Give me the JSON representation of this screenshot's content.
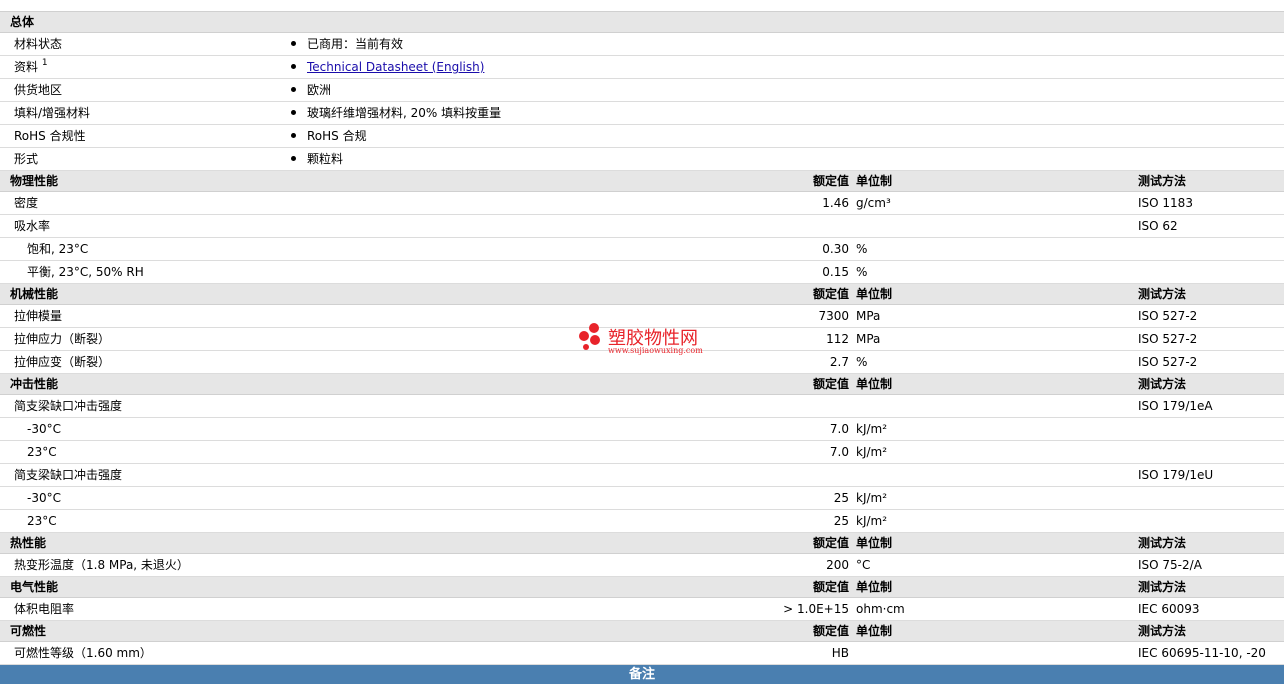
{
  "sections": {
    "general": {
      "title": "总体",
      "rows": [
        {
          "label": "材料状态",
          "value": "已商用：当前有效"
        },
        {
          "label": "资料",
          "sup": "1",
          "value": "Technical Datasheet (English)",
          "link": true
        },
        {
          "label": "供货地区",
          "value": "欧洲"
        },
        {
          "label": "填料/增强材料",
          "value": "玻璃纤维增强材料, 20% 填料按重量"
        },
        {
          "label": "RoHS 合规性",
          "value": "RoHS 合规"
        },
        {
          "label": "形式",
          "value": "颗粒料"
        }
      ]
    },
    "physical": {
      "title": "物理性能",
      "col_value": "额定值",
      "col_unit": "单位制",
      "col_test": "测试方法",
      "rows": [
        {
          "label": "密度",
          "value": "1.46",
          "unit": "g/cm³",
          "test": "ISO 1183",
          "sub": false
        },
        {
          "label": "吸水率",
          "value": "",
          "unit": "",
          "test": "ISO 62",
          "sub": false
        },
        {
          "label": "饱和, 23°C",
          "value": "0.30",
          "unit": "%",
          "test": "",
          "sub": true
        },
        {
          "label": "平衡, 23°C, 50% RH",
          "value": "0.15",
          "unit": "%",
          "test": "",
          "sub": true
        }
      ]
    },
    "mechanical": {
      "title": "机械性能",
      "col_value": "额定值",
      "col_unit": "单位制",
      "col_test": "测试方法",
      "rows": [
        {
          "label": "拉伸模量",
          "value": "7300",
          "unit": "MPa",
          "test": "ISO 527-2",
          "sub": false
        },
        {
          "label": "拉伸应力（断裂）",
          "value": "112",
          "unit": "MPa",
          "test": "ISO 527-2",
          "sub": false
        },
        {
          "label": "拉伸应变（断裂）",
          "value": "2.7",
          "unit": "%",
          "test": "ISO 527-2",
          "sub": false
        }
      ]
    },
    "impact": {
      "title": "冲击性能",
      "col_value": "额定值",
      "col_unit": "单位制",
      "col_test": "测试方法",
      "rows": [
        {
          "label": "简支梁缺口冲击强度",
          "value": "",
          "unit": "",
          "test": "ISO 179/1eA",
          "sub": false
        },
        {
          "label": "-30°C",
          "value": "7.0",
          "unit": "kJ/m²",
          "test": "",
          "sub": true
        },
        {
          "label": "23°C",
          "value": "7.0",
          "unit": "kJ/m²",
          "test": "",
          "sub": true
        },
        {
          "label": "简支梁缺口冲击强度",
          "value": "",
          "unit": "",
          "test": "ISO 179/1eU",
          "sub": false
        },
        {
          "label": "-30°C",
          "value": "25",
          "unit": "kJ/m²",
          "test": "",
          "sub": true
        },
        {
          "label": "23°C",
          "value": "25",
          "unit": "kJ/m²",
          "test": "",
          "sub": true
        }
      ]
    },
    "thermal": {
      "title": "热性能",
      "col_value": "额定值",
      "col_unit": "单位制",
      "col_test": "测试方法",
      "rows": [
        {
          "label": "热变形温度（1.8 MPa, 未退火）",
          "value": "200",
          "unit": "°C",
          "test": "ISO 75-2/A",
          "sub": false
        }
      ]
    },
    "electrical": {
      "title": "电气性能",
      "col_value": "额定值",
      "col_unit": "单位制",
      "col_test": "测试方法",
      "rows": [
        {
          "label": "体积电阻率",
          "value": "> 1.0E+15",
          "unit": "ohm·cm",
          "test": "IEC 60093",
          "sub": false
        }
      ]
    },
    "flammability": {
      "title": "可燃性",
      "col_value": "额定值",
      "col_unit": "单位制",
      "col_test": "测试方法",
      "rows": [
        {
          "label": "可燃性等级（1.60 mm）",
          "value": "HB",
          "unit": "",
          "test": "IEC 60695-11-10, -20",
          "sub": false
        }
      ]
    }
  },
  "notes_title": "备注",
  "watermark": {
    "title": "塑胶物性网",
    "url": "www.sujiaowuxing.com",
    "color": "#e8232a"
  }
}
